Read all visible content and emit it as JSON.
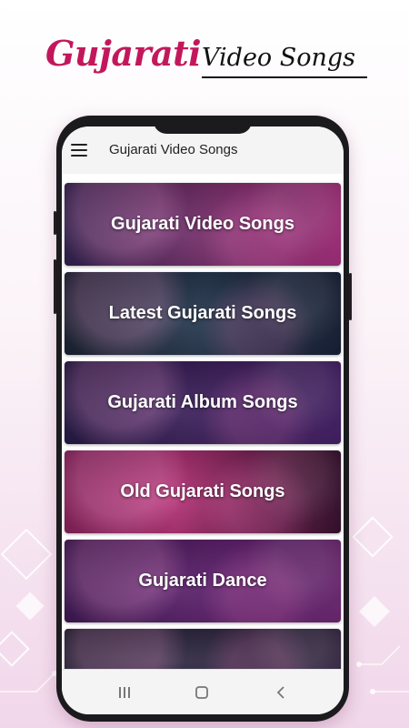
{
  "promo": {
    "title_part1": "Gujarati",
    "title_part2": "Video Songs"
  },
  "app_bar": {
    "title": "Gujarati Video Songs",
    "menu_icon": "hamburger-menu-icon"
  },
  "categories": [
    {
      "label": "Gujarati Video Songs"
    },
    {
      "label": "Latest Gujarati Songs"
    },
    {
      "label": "Gujarati Album Songs"
    },
    {
      "label": "Old Gujarati Songs"
    },
    {
      "label": "Gujarati Dance"
    },
    {
      "label": ""
    }
  ],
  "nav_bar": {
    "recent_icon": "recent-apps-icon",
    "home_icon": "home-icon",
    "back_icon": "back-icon"
  },
  "colors": {
    "brand_pink": "#c2185b",
    "phone_frame": "#1b1b1d"
  }
}
